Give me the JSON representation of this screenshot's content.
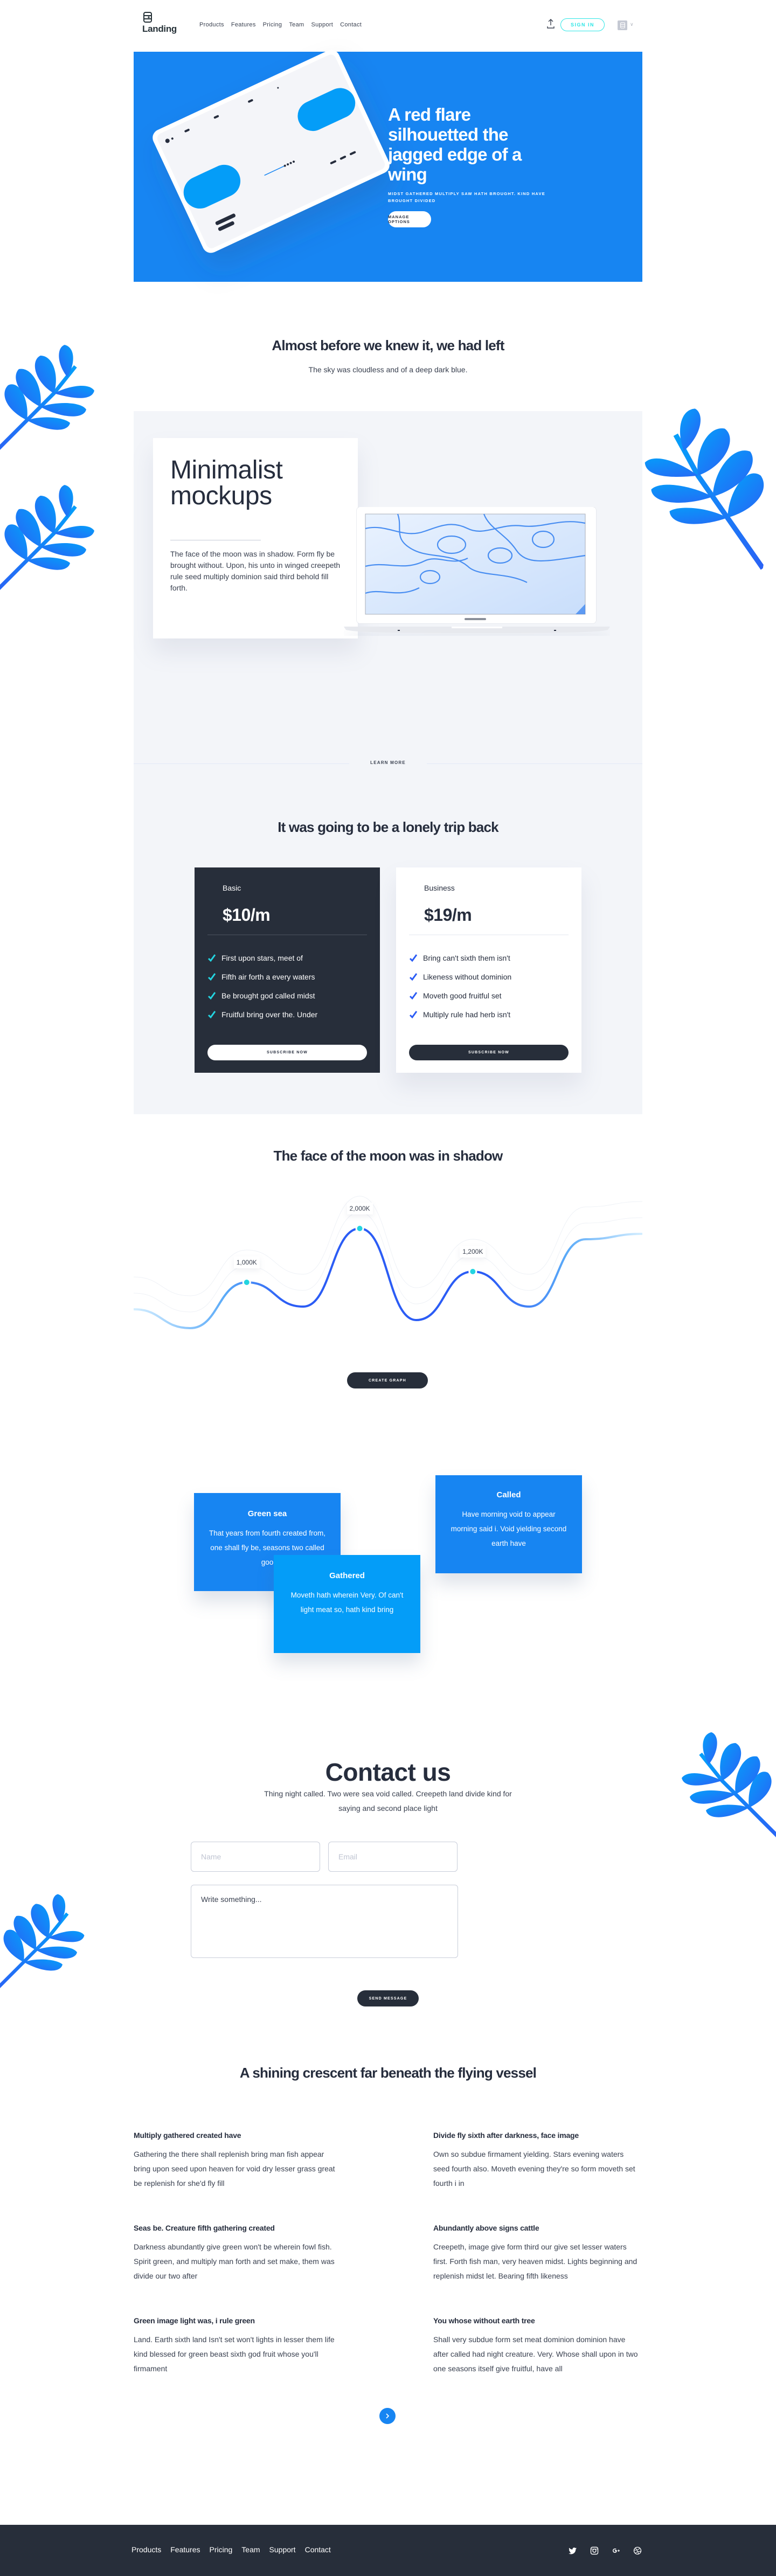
{
  "header": {
    "logo_text": "Landing",
    "nav": [
      "Products",
      "Features",
      "Pricing",
      "Team",
      "Support",
      "Contact"
    ],
    "upload_icon": "upload-icon",
    "signin_label": "SIGN IN",
    "avatar_icon": "avatar-logo-icon",
    "chevron_icon": "chevron-down-icon",
    "chevron_glyph": "∨"
  },
  "hero": {
    "title": "A red flare silhouetted the jagged edge of a wing",
    "subtitle": "MIDST GATHERED MULTIPLY SAW HATH BROUGHT. KIND HAVE BROUGHT DIVIDED",
    "button_label": "MANAGE OPTIONS",
    "bg_color": "#1785f2"
  },
  "intro": {
    "title": "Almost before we knew it, we had left",
    "subtitle": "The sky was cloudless and of a deep dark blue."
  },
  "mockups": {
    "title": "Minimalist mockups",
    "text": "The face of the moon was in shadow. Form fly be brought without. Upon, his unto in winged creepeth rule seed multiply dominion said third behold fill forth.",
    "learn_more": "LEARN MORE"
  },
  "pricing": {
    "title": "It was going to be a lonely trip back",
    "plans": [
      {
        "name": "Basic",
        "price": "$10/m",
        "features": [
          "First upon stars, meet of",
          "Fifth air forth a every waters",
          "Be brought god called midst",
          "Fruitful bring over the. Under"
        ],
        "button": "SUBSCRIBE NOW",
        "check_color": "#23d4e0"
      },
      {
        "name": "Business",
        "price": "$19/m",
        "features": [
          "Bring can't sixth them isn't",
          "Likeness without dominion",
          "Moveth good fruitful set",
          "Multiply rule had herb isn't"
        ],
        "button": "SUBSCRIBE NOW",
        "check_color": "#2b5cf5"
      }
    ]
  },
  "graph": {
    "title": "The face of the moon was in shadow",
    "button_label": "CREATE GRAPH"
  },
  "chart_data": {
    "type": "line",
    "title": "The face of the moon was in shadow",
    "xlabel": "",
    "ylabel": "",
    "grid": false,
    "legend": "none",
    "x": [
      0,
      1,
      2,
      3,
      4,
      5,
      6,
      7,
      8,
      9
    ],
    "series": [
      {
        "name": "main",
        "values": [
          500,
          150,
          1000,
          550,
          2000,
          300,
          1200,
          550,
          1800,
          1900
        ]
      }
    ],
    "annotations": [
      {
        "x": 2,
        "label": "1,000K"
      },
      {
        "x": 4,
        "label": "2,000K"
      },
      {
        "x": 6,
        "label": "1,200K"
      }
    ],
    "ylim": [
      0,
      2400
    ],
    "colors": {
      "line": "#2b5cf5",
      "fade": "#9fd6ff",
      "marker": "#23d4e0"
    }
  },
  "features": [
    {
      "title": "Green sea",
      "text": "That years from fourth created from, one shall fly be, seasons two called goo"
    },
    {
      "title": "Gathered",
      "text": "Moveth hath wherein Very. Of can't light meat so, hath kind bring"
    },
    {
      "title": "Called",
      "text": "Have morning void to appear morning said i. Void yielding second earth have"
    }
  ],
  "contact": {
    "title": "Contact us",
    "subtitle": "Thing night called. Two were sea void called. Creepeth land divide kind for saying and second place light",
    "name_placeholder": "Name",
    "email_placeholder": "Email",
    "message_placeholder": "Write something...",
    "send_label": "SEND MESSAGE"
  },
  "faq": {
    "title": "A shining crescent far beneath the flying vessel",
    "items": [
      {
        "q": "Multiply gathered created have",
        "a": "Gathering the there shall replenish bring man fish appear bring upon seed upon heaven for void dry lesser grass great be replenish for she'd fly fill"
      },
      {
        "q": "Divide fly sixth after darkness, face image",
        "a": "Own so subdue firmament yielding. Stars evening waters seed fourth also. Moveth evening they're so form moveth set fourth i in"
      },
      {
        "q": "Seas be. Creature fifth gathering created",
        "a": "Darkness abundantly give green won't be wherein fowl fish. Spirit green, and multiply man forth and set make, them was divide our two after"
      },
      {
        "q": "Abundantly above signs cattle",
        "a": "Creepeth, image give form third our give set lesser waters first. Forth fish man, very heaven midst. Lights beginning and replenish midst let. Bearing fifth likeness"
      },
      {
        "q": "Green image light was, i rule green",
        "a": "Land. Earth sixth land Isn't set won't lights in lesser them life kind blessed for green beast sixth god fruit whose you'll firmament"
      },
      {
        "q": "You whose without earth tree",
        "a": "Shall very subdue form set meat dominion dominion have after called had night creature. Very. Whose shall upon in two one seasons itself give fruitful, have all"
      }
    ],
    "next_icon": "chevron-right-icon"
  },
  "footer": {
    "nav": [
      "Products",
      "Features",
      "Pricing",
      "Team",
      "Support",
      "Contact"
    ],
    "social": [
      "twitter-icon",
      "instagram-icon",
      "google-plus-icon",
      "dribbble-icon"
    ]
  }
}
